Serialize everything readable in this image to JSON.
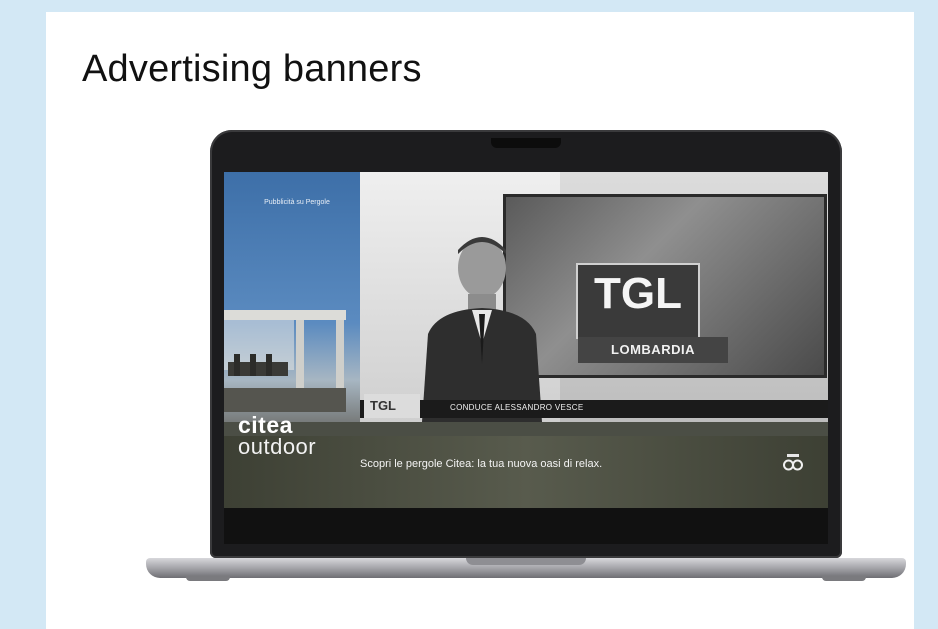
{
  "page": {
    "title": "Advertising banners"
  },
  "screen": {
    "sidebar_ad": {
      "kicker": "Pubblicità su Pergole"
    },
    "broadcast": {
      "logo_big": "TGL",
      "region_big": "LOMBARDIA",
      "lower_third": {
        "logo": "TGL",
        "text": "CONDUCE ALESSANDRO VESCE"
      }
    },
    "banner": {
      "brand_line1": "citea",
      "brand_line2": "outdoor",
      "message": "Scopri le pergole Citea: la tua nuova oasi di relax.",
      "logo_icon": "infinity-logo-icon"
    }
  },
  "colors": {
    "page_background": "#d3e8f5",
    "card_background": "#ffffff",
    "laptop_body": "#1c1c1e",
    "banner_band": "#585b4d"
  }
}
